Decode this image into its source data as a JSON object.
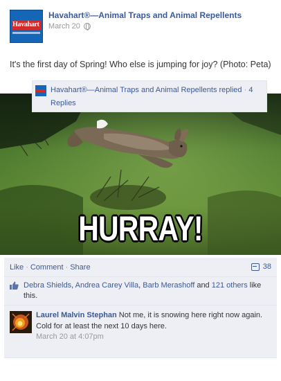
{
  "post": {
    "page_name": "Havahart®—Animal Traps and Animal Repellents",
    "date": "March 20",
    "avatar_logo_text": "Havahart",
    "text": "It's the first day of Spring! Who else is jumping for joy? (Photo: Peta)"
  },
  "photo": {
    "caption": "HURRAY!"
  },
  "actions": {
    "like": "Like",
    "comment": "Comment",
    "share": "Share",
    "separator": "·",
    "comment_count": "38"
  },
  "likes": {
    "names": [
      "Debra Shields",
      "Andrea Carey Villa",
      "Barb Merashoff"
    ],
    "sep1": ", ",
    "sep2": ", ",
    "and_text": " and ",
    "others_text": "121 others",
    "suffix": " like this."
  },
  "comment": {
    "author": "Laurel Malvin Stephan",
    "text": " Not me, it is snowing here right now again. Cold for at least the next 10 days here.",
    "time": "March 20 at 4:07pm"
  },
  "reply": {
    "text": "Havahart®—Animal Traps and Animal Repellents replied",
    "dot": " · ",
    "count": "4 Replies"
  },
  "colors": {
    "link": "#3b5998",
    "feedback_bg": "#edeff4",
    "meta_gray": "#999999"
  }
}
